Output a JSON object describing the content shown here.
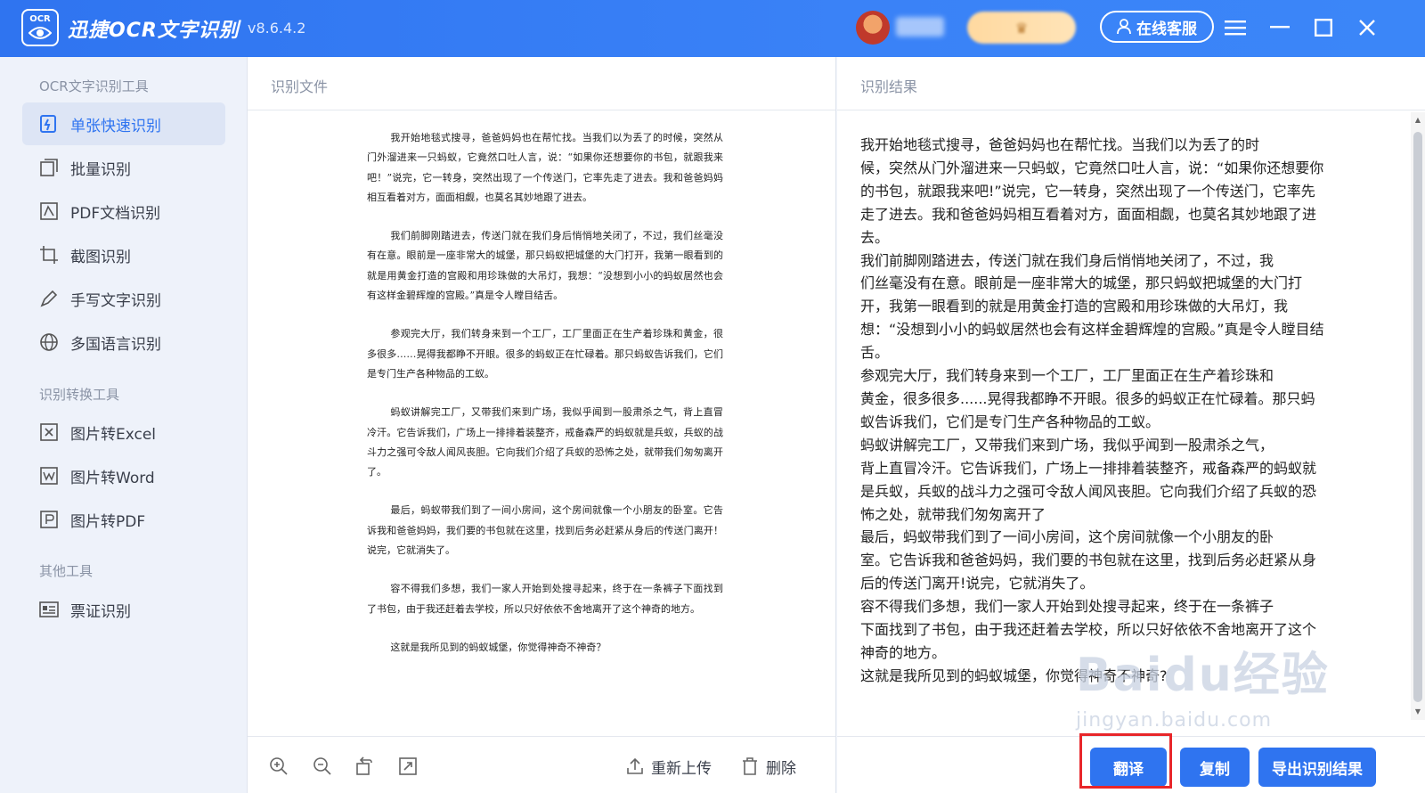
{
  "app": {
    "logo_text": "OCR",
    "title": "迅捷OCR文字识别",
    "version": "v8.6.4.2",
    "service_label": "在线客服"
  },
  "sidebar": {
    "sections": [
      {
        "title": "OCR文字识别工具"
      },
      {
        "title": "识别转换工具"
      },
      {
        "title": "其他工具"
      }
    ],
    "items": [
      {
        "label": "单张快速识别",
        "icon": "single-scan-icon",
        "active": true
      },
      {
        "label": "批量识别",
        "icon": "batch-icon"
      },
      {
        "label": "PDF文档识别",
        "icon": "pdf-doc-icon"
      },
      {
        "label": "截图识别",
        "icon": "crop-icon"
      },
      {
        "label": "手写文字识别",
        "icon": "pen-icon"
      },
      {
        "label": "多国语言识别",
        "icon": "globe-icon"
      },
      {
        "label": "图片转Excel",
        "icon": "excel-icon"
      },
      {
        "label": "图片转Word",
        "icon": "word-icon"
      },
      {
        "label": "图片转PDF",
        "icon": "pdf-icon"
      },
      {
        "label": "票证识别",
        "icon": "id-card-icon"
      }
    ]
  },
  "file_panel": {
    "header": "识别文件",
    "paragraphs": [
      "我开始地毯式搜寻，爸爸妈妈也在帮忙找。当我们以为丢了的时候，突然从门外溜进来一只蚂蚁，它竟然口吐人言，说：“如果你还想要你的书包，就跟我来吧！”说完，它一转身，突然出现了一个传送门，它率先走了进去。我和爸爸妈妈相互看着对方，面面相觑，也莫名其妙地跟了进去。",
      "我们前脚刚踏进去，传送门就在我们身后悄悄地关闭了，不过，我们丝毫没有在意。眼前是一座非常大的城堡，那只蚂蚁把城堡的大门打开，我第一眼看到的就是用黄金打造的宫殿和用珍珠做的大吊灯，我想：“没想到小小的蚂蚁居然也会有这样金碧辉煌的宫殿。”真是令人瞠目结舌。",
      "参观完大厅，我们转身来到一个工厂，工厂里面正在生产着珍珠和黄金，很多很多……晃得我都睁不开眼。很多的蚂蚁正在忙碌着。那只蚂蚁告诉我们，它们是专门生产各种物品的工蚁。",
      "蚂蚁讲解完工厂，又带我们来到广场，我似乎闻到一股肃杀之气，背上直冒冷汗。它告诉我们，广场上一排排着装整齐，戒备森严的蚂蚁就是兵蚁，兵蚁的战斗力之强可令敌人闻风丧胆。它向我们介绍了兵蚁的恐怖之处，就带我们匆匆离开了。",
      "最后，蚂蚁带我们到了一间小房间，这个房间就像一个小朋友的卧室。它告诉我和爸爸妈妈，我们要的书包就在这里，找到后务必赶紧从身后的传送门离开！说完，它就消失了。",
      "容不得我们多想，我们一家人开始到处搜寻起来，终于在一条裤子下面找到了书包，由于我还赶着去学校，所以只好依依不舍地离开了这个神奇的地方。",
      "这就是我所见到的蚂蚁城堡，你觉得神奇不神奇？"
    ],
    "toolbar": {
      "zoom_in_icon": "zoom-in-icon",
      "zoom_out_icon": "zoom-out-icon",
      "rotate_icon": "rotate-icon",
      "fit_icon": "fit-screen-icon",
      "reupload_label": "重新上传",
      "delete_label": "删除"
    }
  },
  "result_panel": {
    "header": "识别结果",
    "lines": [
      "我开始地毯式搜寻，爸爸妈妈也在帮忙找。当我们以为丢了的时",
      "候，突然从门外溜进来一只蚂蚁，它竟然口吐人言，说：“如果你还想要你",
      "的书包，就跟我来吧!”说完，它一转身，突然出现了一个传送门，它率先",
      "走了进去。我和爸爸妈妈相互看着对方，面面相觑，也莫名其妙地跟了进",
      "去。",
      "我们前脚刚踏进去，传送门就在我们身后悄悄地关闭了，不过，我",
      "们丝毫没有在意。眼前是一座非常大的城堡，那只蚂蚁把城堡的大门打",
      "开，我第一眼看到的就是用黄金打造的宫殿和用珍珠做的大吊灯，我",
      "想：“没想到小小的蚂蚁居然也会有这样金碧辉煌的宫殿。”真是令人瞠目结",
      "舌。",
      "参观完大厅，我们转身来到一个工厂，工厂里面正在生产着珍珠和",
      "黄金，很多很多......晃得我都睁不开眼。很多的蚂蚁正在忙碌着。那只蚂",
      "蚁告诉我们，它们是专门生产各种物品的工蚁。",
      "蚂蚁讲解完工厂，又带我们来到广场，我似乎闻到一股肃杀之气，",
      "背上直冒冷汗。它告诉我们，广场上一排排着装整齐，戒备森严的蚂蚁就",
      "是兵蚁，兵蚁的战斗力之强可令敌人闻风丧胆。它向我们介绍了兵蚁的恐",
      "怖之处，就带我们匆匆离开了",
      "最后，蚂蚁带我们到了一间小房间，这个房间就像一个小朋友的卧",
      "室。它告诉我和爸爸妈妈，我们要的书包就在这里，找到后务必赶紧从身",
      "后的传送门离开!说完，它就消失了。",
      "容不得我们多想，我们一家人开始到处搜寻起来，终于在一条裤子",
      "下面找到了书包，由于我还赶着去学校，所以只好依依不舍地离开了这个",
      "神奇的地方。",
      "这就是我所见到的蚂蚁城堡，你觉得神奇不神奇?"
    ],
    "buttons": {
      "translate": "翻译",
      "copy": "复制",
      "export": "导出识别结果"
    }
  },
  "watermark": {
    "main": "Baidu经验",
    "sub": "jingyan.baidu.com"
  },
  "colors": {
    "brand": "#2f74f0",
    "highlight": "#e8262a"
  }
}
